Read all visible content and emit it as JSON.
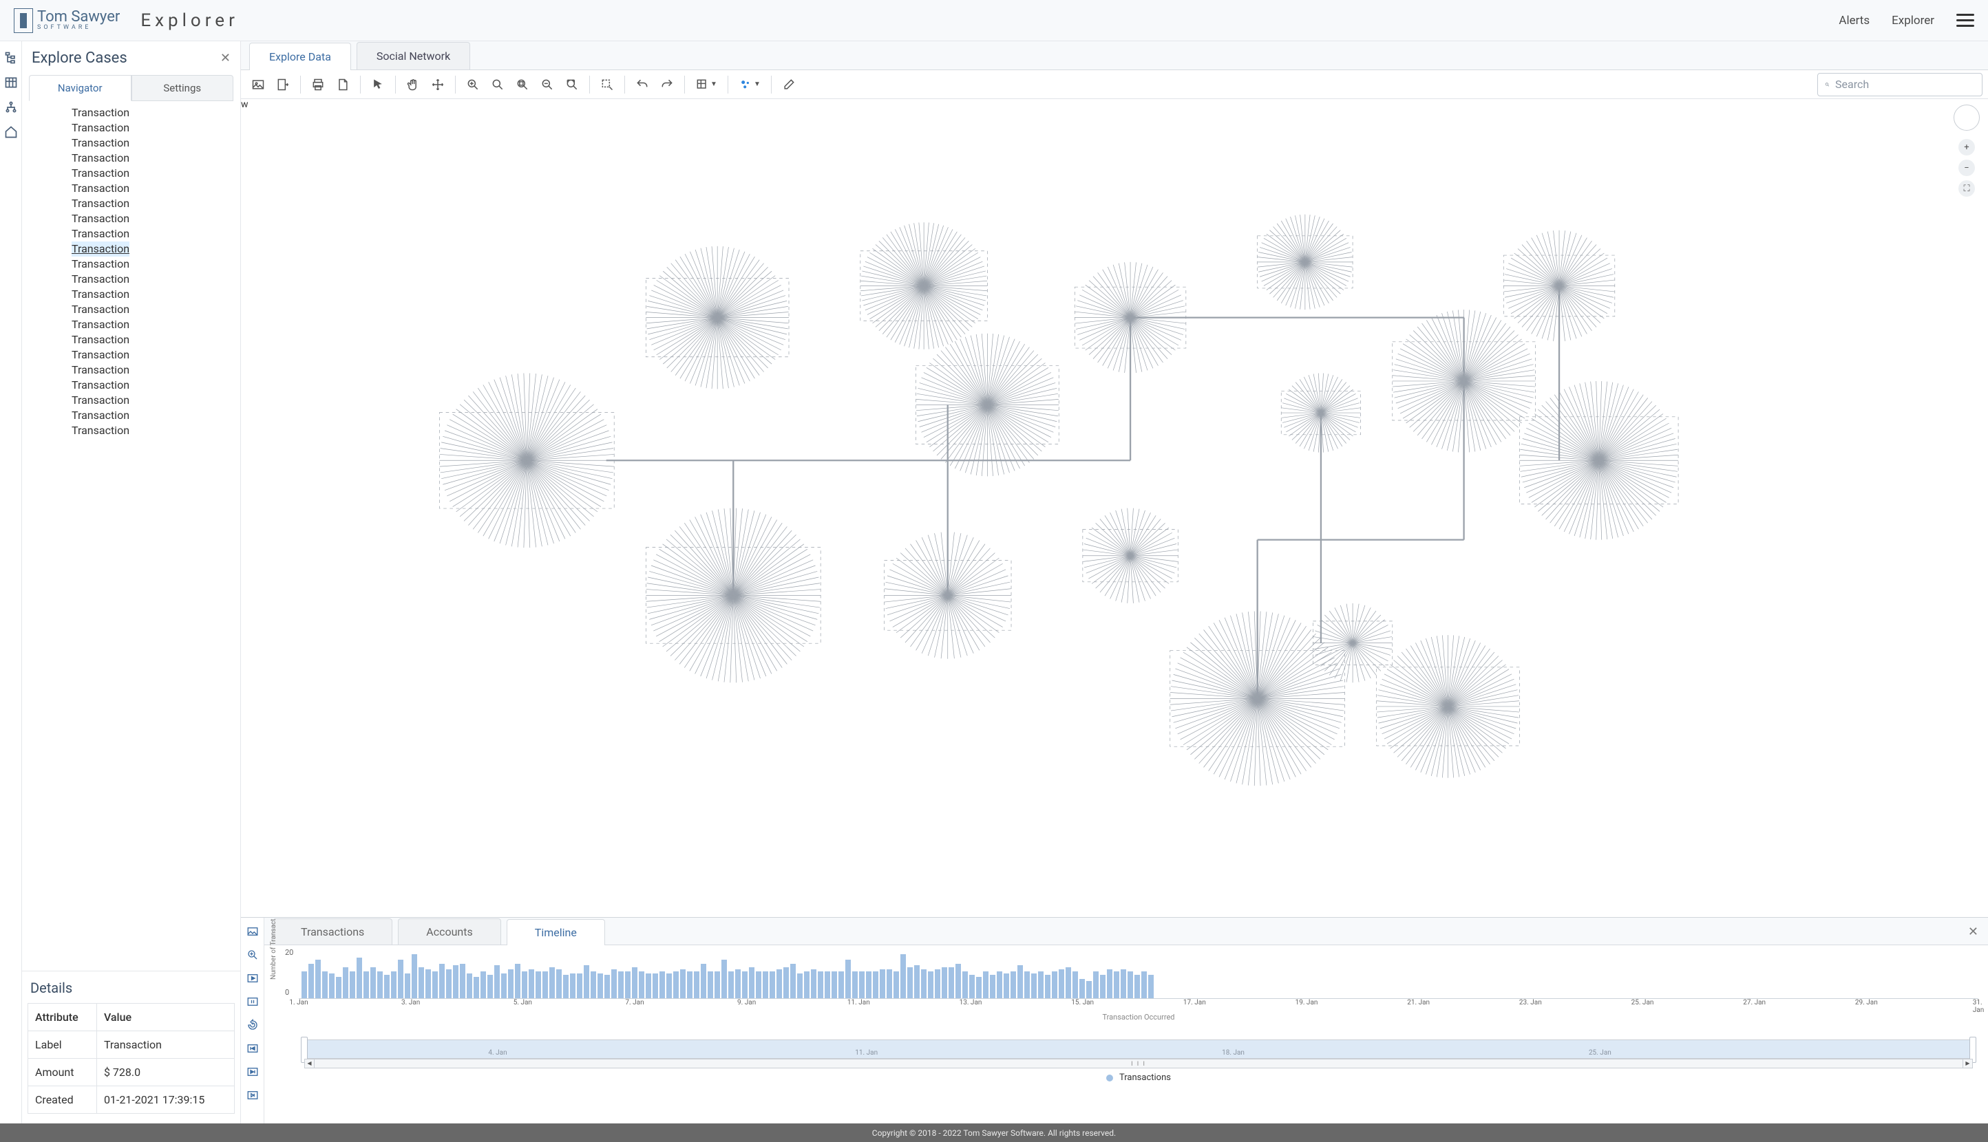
{
  "header": {
    "brand_line1": "Tom Sawyer",
    "brand_line2": "SOFTWARE",
    "app_title": "Explorer",
    "nav": {
      "alerts": "Alerts",
      "explorer": "Explorer"
    }
  },
  "left_rail_icons": [
    "tree-icon",
    "table-icon",
    "org-icon",
    "home-icon"
  ],
  "explore": {
    "title": "Explore Cases",
    "tabs": {
      "navigator": "Navigator",
      "settings": "Settings"
    },
    "active_tab": "Navigator",
    "tree_items": [
      "Transaction",
      "Transaction",
      "Transaction",
      "Transaction",
      "Transaction",
      "Transaction",
      "Transaction",
      "Transaction",
      "Transaction",
      "Transaction",
      "Transaction",
      "Transaction",
      "Transaction",
      "Transaction",
      "Transaction",
      "Transaction",
      "Transaction",
      "Transaction",
      "Transaction",
      "Transaction",
      "Transaction",
      "Transaction"
    ],
    "selected_index": 9
  },
  "details": {
    "title": "Details",
    "header": {
      "attr": "Attribute",
      "val": "Value"
    },
    "rows": [
      {
        "attr": "Label",
        "val": "Transaction"
      },
      {
        "attr": "Amount",
        "val": "$ 728.0"
      },
      {
        "attr": "Created",
        "val": "01-21-2021 17:39:15"
      }
    ]
  },
  "main_tabs": {
    "explore_data": "Explore Data",
    "social_network": "Social Network",
    "active": "Explore Data"
  },
  "graph_toolbar_icons": [
    "image-icon",
    "export-icon",
    "print-icon",
    "page-icon",
    "pointer-icon",
    "hand-icon",
    "move-icon",
    "zoom-in-icon",
    "zoom-default-icon",
    "zoom-area-icon",
    "zoom-out-icon",
    "zoom-fit-icon",
    "highlight-icon",
    "undo-icon",
    "redo-icon",
    "layout-icon",
    "cluster-icon",
    "erase-icon"
  ],
  "search": {
    "placeholder": "Search"
  },
  "bottom": {
    "tabs": {
      "transactions": "Transactions",
      "accounts": "Accounts",
      "timeline": "Timeline",
      "active": "Timeline"
    },
    "side_icons": [
      "image-icon",
      "zoom-in-icon",
      "play-icon",
      "pause-icon",
      "restart-icon",
      "skip-back-icon",
      "skip-fwd-icon",
      "step-fwd-icon"
    ]
  },
  "chart_data": {
    "type": "bar",
    "title": "",
    "ylabel": "Number of Transact",
    "xlabel": "Transaction Occurred",
    "ylim": [
      0,
      25
    ],
    "yticks": [
      0,
      20
    ],
    "legend": [
      "Transactions"
    ],
    "x_tick_labels": [
      "1. Jan",
      "3. Jan",
      "5. Jan",
      "7. Jan",
      "9. Jan",
      "11. Jan",
      "13. Jan",
      "15. Jan",
      "17. Jan",
      "19. Jan",
      "21. Jan",
      "23. Jan",
      "25. Jan",
      "27. Jan",
      "29. Jan",
      "31. Jan"
    ],
    "range_tick_labels": [
      "4. Jan",
      "11. Jan",
      "18. Jan",
      "25. Jan"
    ],
    "series": [
      {
        "name": "Transactions",
        "values": [
          14,
          18,
          20,
          14,
          13,
          11,
          16,
          14,
          21,
          14,
          16,
          14,
          12,
          14,
          20,
          13,
          23,
          16,
          15,
          14,
          18,
          15,
          17,
          18,
          13,
          11,
          14,
          12,
          17,
          13,
          15,
          18,
          14,
          15,
          14,
          14,
          16,
          15,
          12,
          13,
          13,
          17,
          14,
          13,
          12,
          15,
          14,
          14,
          16,
          14,
          13,
          13,
          14,
          13,
          14,
          15,
          14,
          14,
          18,
          14,
          14,
          20,
          14,
          15,
          14,
          16,
          14,
          14,
          14,
          15,
          16,
          18,
          13,
          14,
          15,
          14,
          14,
          14,
          14,
          20,
          14,
          14,
          14,
          14,
          15,
          15,
          14,
          23,
          16,
          17,
          15,
          14,
          15,
          16,
          16,
          18,
          14,
          12,
          11,
          14,
          12,
          14,
          13,
          14,
          17,
          14,
          13,
          14,
          12,
          14,
          15,
          16,
          14,
          10,
          9,
          14,
          12,
          15,
          14,
          15,
          14,
          12,
          14,
          12
        ]
      }
    ]
  },
  "footer": "Copyright © 2018 - 2022 Tom Sawyer Software. All rights reserved."
}
